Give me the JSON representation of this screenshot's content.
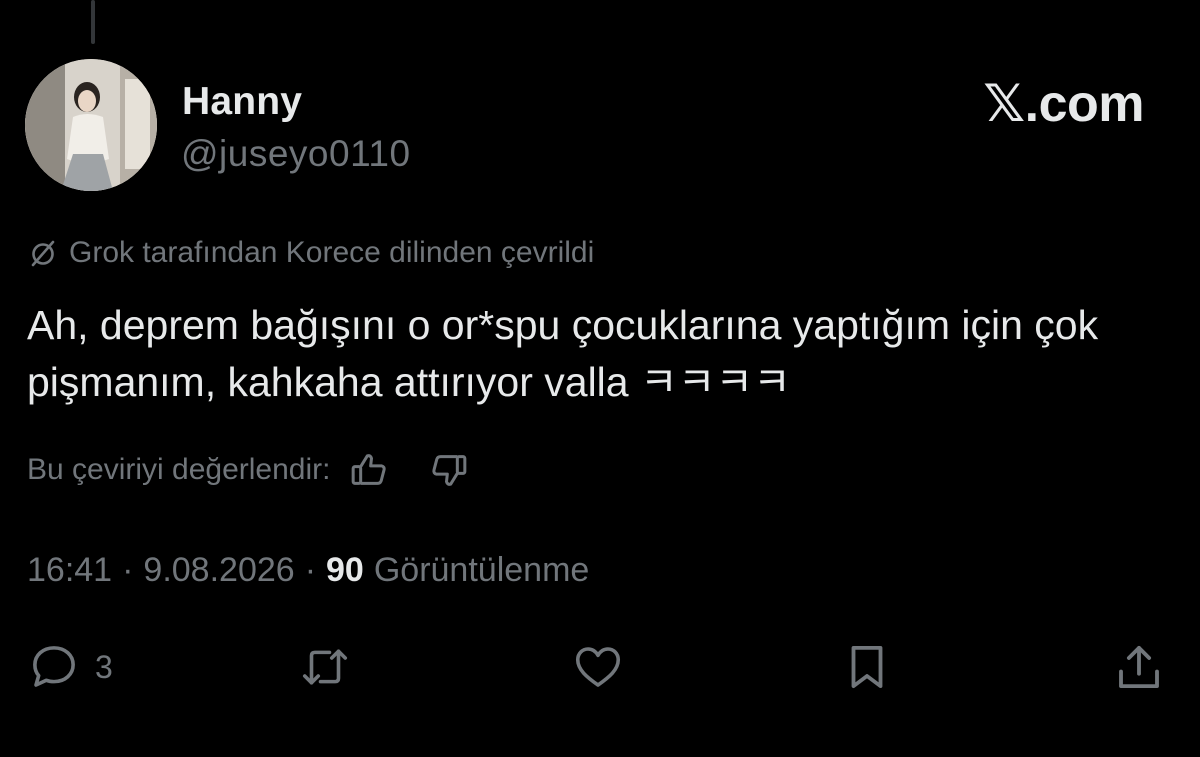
{
  "author": {
    "display_name": "Hanny",
    "handle": "@juseyo0110",
    "avatar_icon": "avatar-photo"
  },
  "brand": "𝕏.com",
  "translation": {
    "icon": "translate-slash-icon",
    "note": "Grok tarafından Korece dilinden çevrildi"
  },
  "tweet": {
    "text": "Ah, deprem bağışını o or*spu çocuklarına yaptığım için çok pişmanım, kahkaha attırıyor valla ㅋㅋㅋㅋ"
  },
  "rate": {
    "label": "Bu çeviriyi değerlendir:",
    "up_icon": "thumbs-up-icon",
    "down_icon": "thumbs-down-icon"
  },
  "meta": {
    "time": "16:41",
    "separator": "·",
    "date": "9.08.2026",
    "views_count": "90",
    "views_label": "Görüntülenme"
  },
  "actions": {
    "reply_count": "3"
  },
  "colors": {
    "background": "#000000",
    "primary_text": "#e7e9ea",
    "secondary_text": "#71767b"
  }
}
